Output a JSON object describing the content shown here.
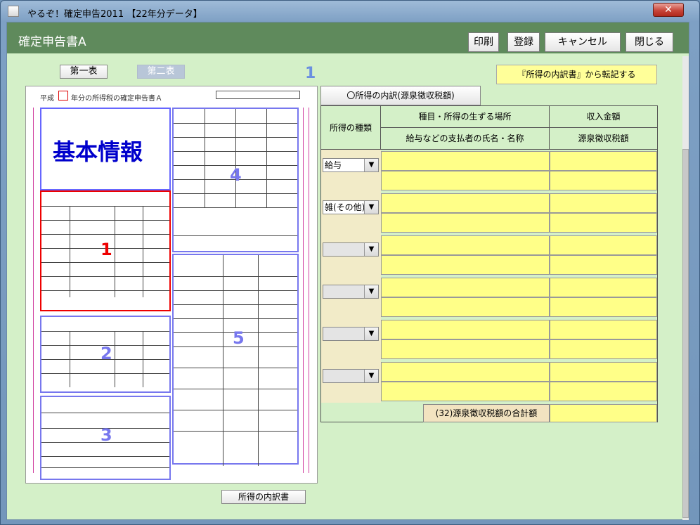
{
  "window": {
    "title": "やるぞ！確定申告2011 【22年分データ】",
    "close_label": "✕"
  },
  "header": {
    "title": "確定申告書A",
    "buttons": {
      "print": "印刷",
      "register": "登録",
      "cancel": "キャンセル",
      "close": "閉じる"
    }
  },
  "sheet_tabs": {
    "first": "第一表",
    "second": "第二表"
  },
  "zone_numbers": {
    "top": "1",
    "z1": "1",
    "z2": "2",
    "z3": "3",
    "z4": "4",
    "z5": "5"
  },
  "form_preview": {
    "title_prefix": "平成",
    "year": "",
    "title_suffix": "年分の所得税の確定申告書Ａ",
    "basic_info": "基本情報"
  },
  "transfer_note": "『所得の内訳書』から転記する",
  "income_tab": "〇所得の内訳(源泉徴収税額)",
  "table": {
    "col_type": "所得の種類",
    "col_place": "種目・所得の生ずる場所",
    "col_payer": "給与などの支払者の氏名・名称",
    "col_income": "収入金額",
    "col_tax": "源泉徴収税額",
    "rows": [
      {
        "type": "給与"
      },
      {
        "type": "雑(その他)"
      },
      {
        "type": ""
      },
      {
        "type": ""
      },
      {
        "type": ""
      },
      {
        "type": ""
      }
    ],
    "total_label": "(32)源泉徴収税額の合計額"
  },
  "bottom_button": "所得の内訳書"
}
